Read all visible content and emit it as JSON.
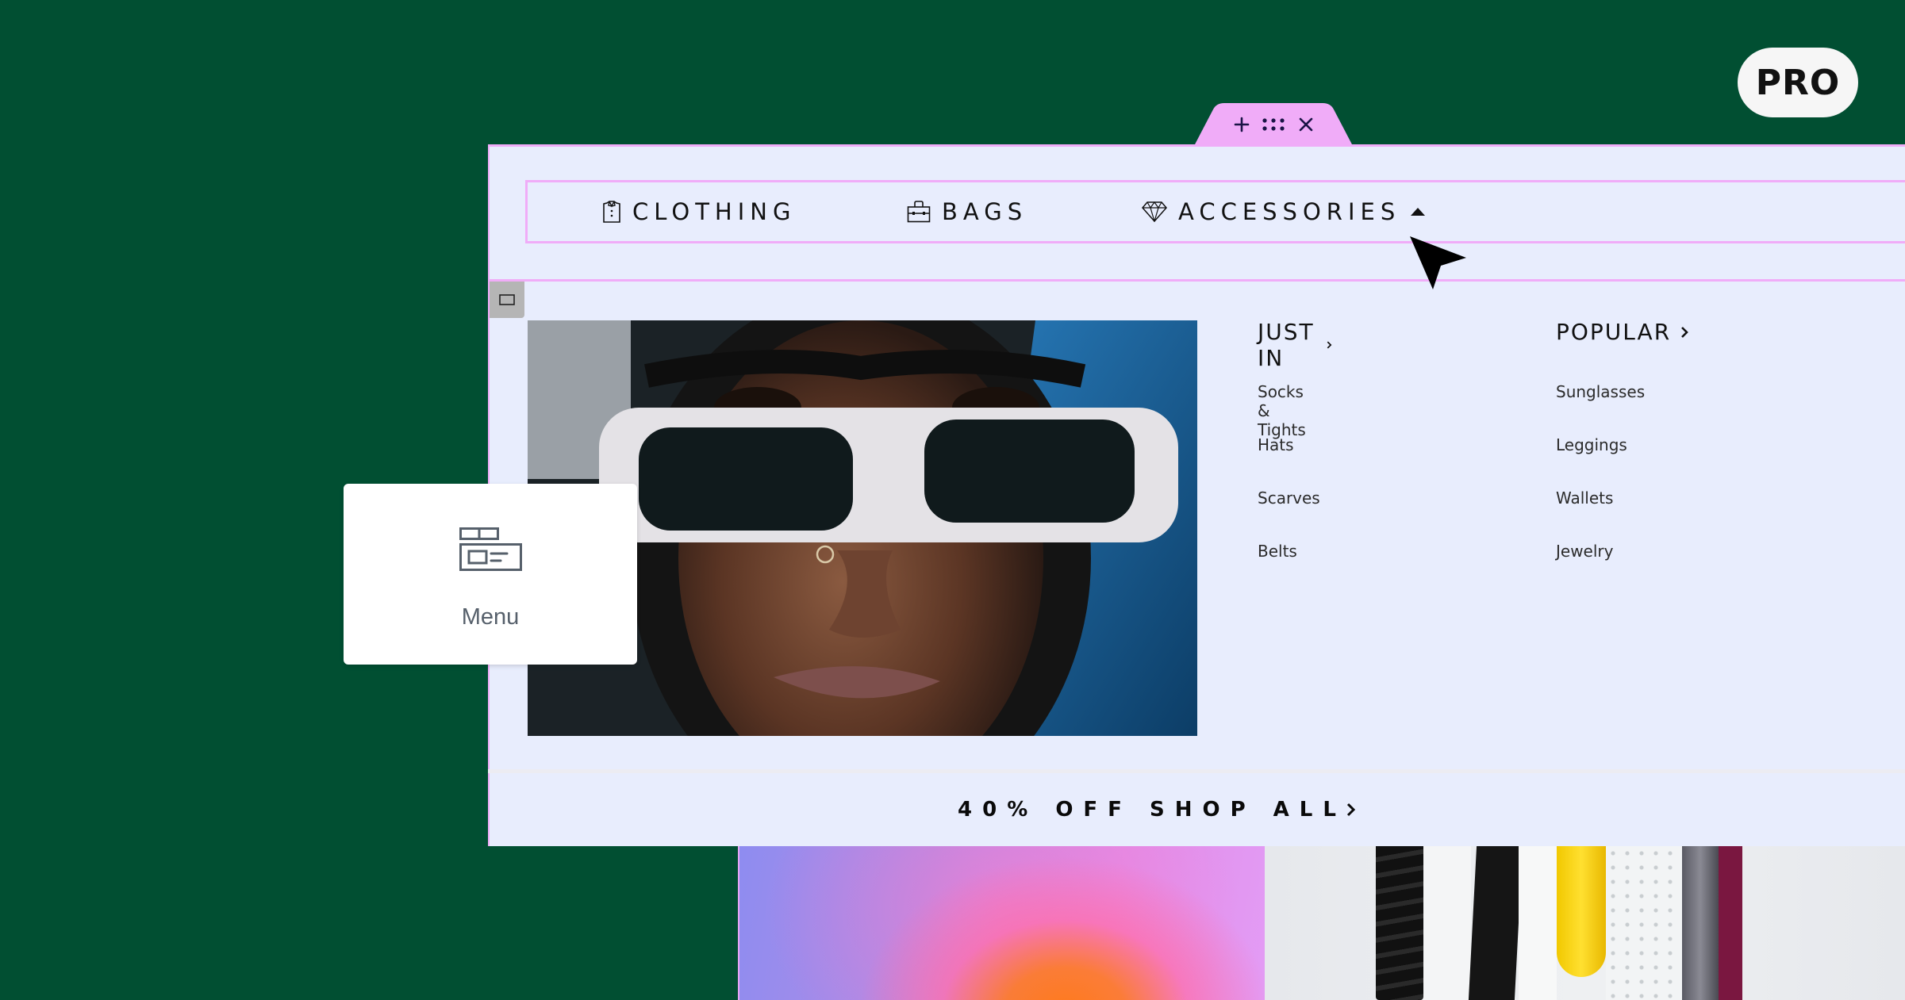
{
  "badge": {
    "label": "PRO"
  },
  "editor_toolbar": {
    "icons": [
      "plus-icon",
      "drag-handle-icon",
      "close-icon"
    ],
    "color": "#F0ACF8"
  },
  "nav": {
    "items": [
      {
        "label": "CLOTHING",
        "icon": "shirt-icon"
      },
      {
        "label": "BAGS",
        "icon": "bag-icon"
      },
      {
        "label": "ACCESSORIES",
        "icon": "diamond-icon",
        "expanded": true
      }
    ]
  },
  "mega_menu": {
    "columns": [
      {
        "heading": "JUST IN",
        "items": [
          "Socks & Tights",
          "Hats",
          "Scarves",
          "Belts"
        ]
      },
      {
        "heading": "POPULAR",
        "items": [
          "Sunglasses",
          "Leggings",
          "Wallets",
          "Jewelry"
        ]
      }
    ],
    "image_alt": "Person wearing white rectangular sunglasses and a blue hood"
  },
  "promo": {
    "label": "40% OFF SHOP ALL"
  },
  "widget_card": {
    "label": "Menu",
    "icon": "menu-widget-icon"
  },
  "colors": {
    "background": "#014F32",
    "panel": "#E8EDFD",
    "accent_pink": "#F0ACF8",
    "toolbar_icon": "#1A1446",
    "widget_text": "#56606B"
  }
}
